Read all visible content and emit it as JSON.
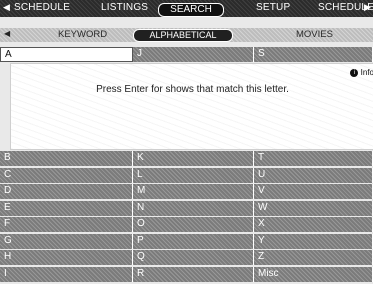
{
  "top_nav": {
    "items": [
      "SCHEDULE",
      "LISTINGS",
      "SEARCH",
      "SETUP",
      "SCHEDULE"
    ]
  },
  "sub_tabs": {
    "items": [
      "KEYWORD",
      "ALPHABETICAL",
      "MOVIES"
    ]
  },
  "letter_row_top": [
    "A",
    "J",
    "S"
  ],
  "info_panel": {
    "message": "Press Enter for shows that match this letter.",
    "badge_text": "Info"
  },
  "letter_grid": [
    [
      "B",
      "K",
      "T"
    ],
    [
      "C",
      "L",
      "U"
    ],
    [
      "D",
      "M",
      "V"
    ],
    [
      "E",
      "N",
      "W"
    ],
    [
      "F",
      "O",
      "X"
    ],
    [
      "G",
      "P",
      "Y"
    ],
    [
      "H",
      "Q",
      "Z"
    ],
    [
      "I",
      "R",
      "Misc"
    ]
  ],
  "colors": {
    "topbar_bg": "#2b2b2b",
    "cell_bg": "#7b7b7b",
    "selected_pill": "#111111"
  }
}
